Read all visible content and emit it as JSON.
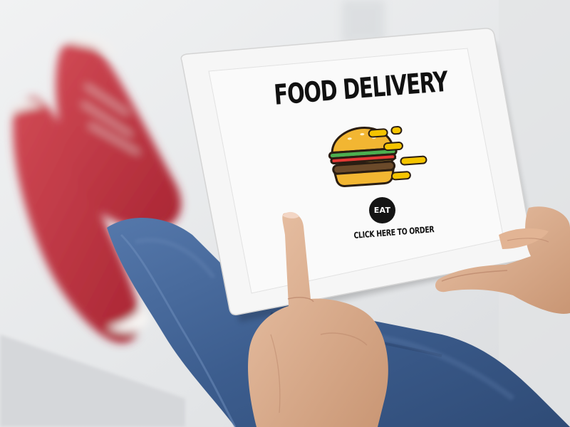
{
  "screen": {
    "headline": "FOOD DELIVERY",
    "badge_label": "EAT",
    "cta_label": "CLICK HERE TO ORDER"
  },
  "icons": {
    "burger": "burger-icon",
    "speed_lines": "speed-lines-icon"
  },
  "colors": {
    "bun": "#f2b632",
    "patty": "#6b4a2a",
    "lettuce": "#4caf50",
    "tomato": "#e53935",
    "cheese": "#f7d54a",
    "speed_lines": "#f5c400",
    "jeans": "#3f5f8f",
    "shoes": "#c0313e",
    "tablet_frame": "#f4f4f4"
  }
}
